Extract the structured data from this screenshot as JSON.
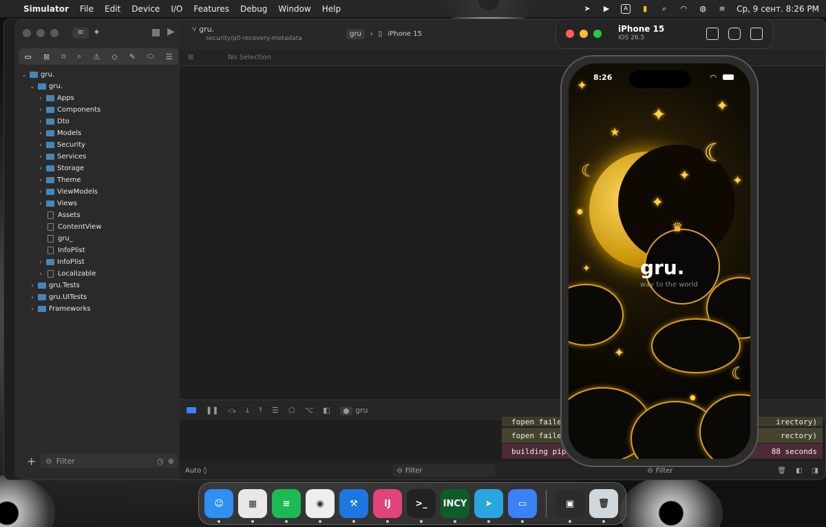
{
  "menubar": {
    "app": "Simulator",
    "items": [
      "File",
      "Edit",
      "Device",
      "I/O",
      "Features",
      "Debug",
      "Window",
      "Help"
    ],
    "clock": "Ср, 9 сент.  8:26 PM"
  },
  "xcode": {
    "navigator": {
      "items": [
        {
          "label": "gru.",
          "level": 0,
          "kind": "project",
          "chevron": "open"
        },
        {
          "label": "gru.",
          "level": 1,
          "kind": "folder",
          "chevron": "open"
        },
        {
          "label": "Apps",
          "level": 2,
          "kind": "folder",
          "chevron": "closed"
        },
        {
          "label": "Components",
          "level": 2,
          "kind": "folder",
          "chevron": "closed"
        },
        {
          "label": "Dto",
          "level": 2,
          "kind": "folder",
          "chevron": "closed"
        },
        {
          "label": "Models",
          "level": 2,
          "kind": "folder",
          "chevron": "closed"
        },
        {
          "label": "Security",
          "level": 2,
          "kind": "folder",
          "chevron": "closed"
        },
        {
          "label": "Services",
          "level": 2,
          "kind": "folder",
          "chevron": "closed"
        },
        {
          "label": "Storage",
          "level": 2,
          "kind": "folder",
          "chevron": "closed"
        },
        {
          "label": "Theme",
          "level": 2,
          "kind": "folder",
          "chevron": "closed"
        },
        {
          "label": "ViewModels",
          "level": 2,
          "kind": "folder",
          "chevron": "closed"
        },
        {
          "label": "Views",
          "level": 2,
          "kind": "folder",
          "chevron": "closed"
        },
        {
          "label": "Assets",
          "level": 2,
          "kind": "file",
          "chevron": "none"
        },
        {
          "label": "ContentView",
          "level": 2,
          "kind": "file",
          "chevron": "none"
        },
        {
          "label": "gru_",
          "level": 2,
          "kind": "file",
          "chevron": "none"
        },
        {
          "label": "InfoPlist",
          "level": 2,
          "kind": "file",
          "chevron": "none"
        },
        {
          "label": "InfoPlist",
          "level": 2,
          "kind": "folder",
          "chevron": "closed"
        },
        {
          "label": "Localizable",
          "level": 2,
          "kind": "file",
          "chevron": "closed"
        },
        {
          "label": "gru.Tests",
          "level": 1,
          "kind": "folder",
          "chevron": "closed"
        },
        {
          "label": "gru.UITests",
          "level": 1,
          "kind": "folder",
          "chevron": "closed"
        },
        {
          "label": "Frameworks",
          "level": 1,
          "kind": "folder",
          "chevron": "closed"
        }
      ],
      "filter_placeholder": "Filter",
      "add_label": "+"
    },
    "toolbar": {
      "project": "gru.",
      "branch": "security/p0-recovery-metadata",
      "scheme": "gru",
      "destination": "iPhone 15"
    },
    "jumpbar": {
      "text": "No Selection"
    },
    "debug": {
      "target": "gru"
    },
    "console": {
      "lines": [
        {
          "text": "fopen faile",
          "tail": "rectory)",
          "color": "#4a4a30"
        },
        {
          "text": "fopen faile",
          "tail": "rectory)",
          "color": "#4b4a30"
        },
        {
          "text": "building pip",
          "tail": "88 seconds",
          "color": "#4a2a36"
        }
      ],
      "top_fragment_left": "fopen faile",
      "top_fragment_right": "irectory)"
    },
    "bottombar": {
      "auto": "Auto ◊",
      "filter_left": "Filter",
      "filter_right": "Filter"
    }
  },
  "simulator": {
    "device": "iPhone 15",
    "os": "iOS 26.5",
    "time": "8:26",
    "app_logo": "gru.",
    "tagline": "way to the world"
  },
  "dock": {
    "items": [
      {
        "name": "Finder",
        "color": "#2e8ff5",
        "glyph": "☺"
      },
      {
        "name": "Launchpad",
        "color": "#e8e8e8",
        "glyph": "▦"
      },
      {
        "name": "Spotify",
        "color": "#1db954",
        "glyph": "≋"
      },
      {
        "name": "Chrome",
        "color": "#eeeeee",
        "glyph": "◉"
      },
      {
        "name": "Xcode",
        "color": "#1c77e0",
        "glyph": "⚒"
      },
      {
        "name": "IntelliJ",
        "color": "#e1447a",
        "glyph": "IJ"
      },
      {
        "name": "Terminal",
        "color": "#222222",
        "glyph": ">_"
      },
      {
        "name": "Incy",
        "color": "#0f5c2b",
        "glyph": "INCY"
      },
      {
        "name": "Telegram",
        "color": "#2aa5e0",
        "glyph": "➤"
      },
      {
        "name": "Screens",
        "color": "#3b82f6",
        "glyph": "▭"
      }
    ],
    "right_items": [
      {
        "name": "Downloads",
        "color": "#2b2b2b",
        "glyph": "▣"
      },
      {
        "name": "Trash",
        "color": "#cfd8dc",
        "glyph": "🗑"
      }
    ]
  }
}
